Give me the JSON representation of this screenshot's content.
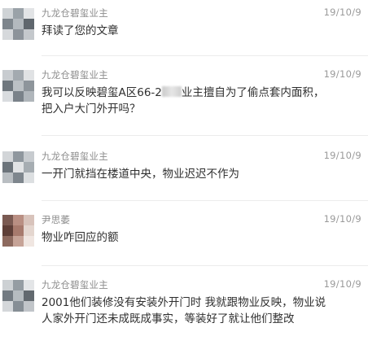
{
  "comments": [
    {
      "username": "九龙仓碧玺业主",
      "date": "19/10/9",
      "text": "拜读了您的文章",
      "avatar_colors": [
        "#cfd3d6",
        "#9aa2a8",
        "#e2e4e6",
        "#7d858c",
        "#b3b9be",
        "#5f666d",
        "#d6d9dc",
        "#8c939a",
        "#c4c8cc"
      ]
    },
    {
      "username": "九龙仓碧玺业主",
      "date": "19/10/9",
      "text_before_mask": "我可以反映碧玺A区66-2",
      "text_after_mask": "业主擅自为了偷点套内面积，把入户大门外开吗？",
      "avatar_colors": [
        "#c8ccd0",
        "#a3aab0",
        "#e0e2e4",
        "#6f777e",
        "#bcc1c5",
        "#8e959b",
        "#d9dcdf",
        "#7a8289",
        "#b0b6bb"
      ]
    },
    {
      "username": "九龙仓碧玺业主",
      "date": "19/10/9",
      "text": "一开门就挡在楼道中央，物业迟迟不作为",
      "avatar_colors": [
        "#d2d5d8",
        "#8f979e",
        "#c7cbcf",
        "#6c747b",
        "#e1e3e5",
        "#a6adb2",
        "#b9bec2",
        "#7e868d",
        "#dcdfe1"
      ]
    },
    {
      "username": "尹思萎",
      "date": "19/10/9",
      "text": "物业咋回应的额",
      "avatar_colors": [
        "#7a5a52",
        "#b98f83",
        "#d8c3bb",
        "#5e3f38",
        "#a77a6d",
        "#e4d6cf",
        "#8d6a5f",
        "#c6a397",
        "#f0e6e1"
      ]
    },
    {
      "username": "九龙仓碧玺业主",
      "date": "19/10/9",
      "text": "2001他们装修没有安装外开门时 我就跟物业反映，物业说人家外开门还未成既成事实，等装好了就让他们整改",
      "avatar_colors": [
        "#cdd1d4",
        "#959da3",
        "#e3e5e7",
        "#737b82",
        "#b6bcc0",
        "#62696f",
        "#d4d7da",
        "#868e95",
        "#c1c5c9"
      ]
    }
  ]
}
